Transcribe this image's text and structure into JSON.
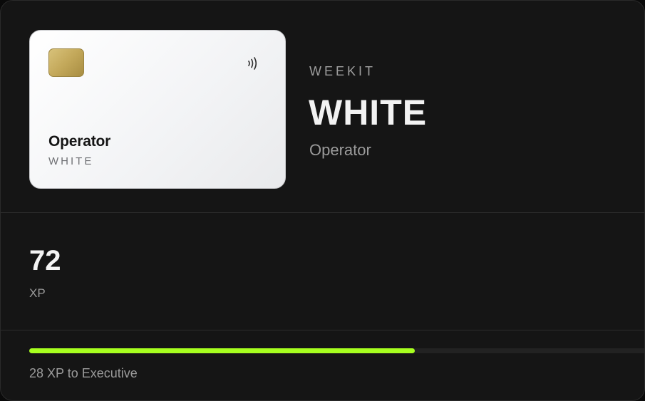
{
  "card": {
    "name": "Operator",
    "tier": "WHITE",
    "chip_icon": "chip-icon",
    "contactless_icon": "contactless-icon"
  },
  "header": {
    "brand": "WEEKIT",
    "tier_title": "WHITE",
    "tier_subtitle": "Operator"
  },
  "stats": {
    "xp_value": "72",
    "xp_label": "XP"
  },
  "progress": {
    "fraction": 0.626,
    "text": "28 XP to Executive"
  },
  "colors": {
    "accent": "#a7ff1f",
    "panel_bg": "#151515",
    "card_bg": "#f3f4f6"
  }
}
